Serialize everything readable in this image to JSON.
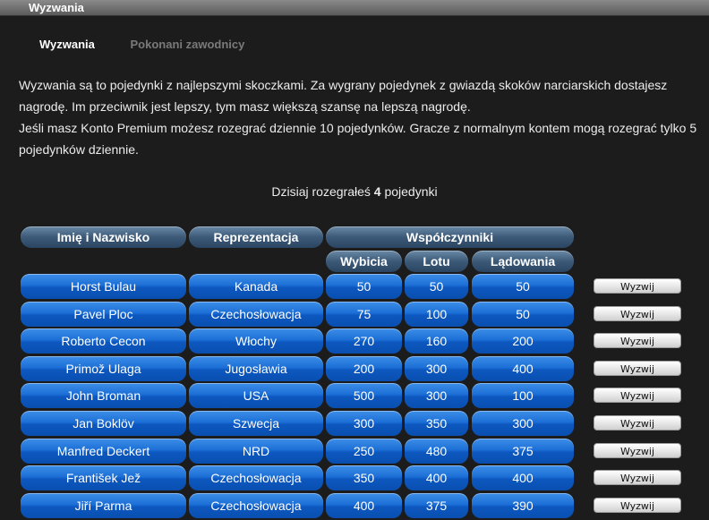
{
  "window": {
    "title": "Wyzwania"
  },
  "tabs": [
    {
      "label": "Wyzwania",
      "active": true
    },
    {
      "label": "Pokonani zawodnicy",
      "active": false
    }
  ],
  "intro": {
    "line1": "Wyzwania są to pojedynki z najlepszymi skoczkami. Za wygrany pojedynek z gwiazdą skoków narciarskich dostajesz nagrodę. Im przeciwnik jest lepszy, tym masz większą szansę na lepszą nagrodę.",
    "line2": "Jeśli masz Konto Premium możesz rozegrać dziennie 10 pojedynków. Gracze z normalnym kontem mogą rozegrać tylko 5 pojedynków dziennie."
  },
  "today": {
    "prefix": "Dzisiaj rozegrałeś ",
    "count": "4",
    "suffix": " pojedynki"
  },
  "table": {
    "headers": {
      "name": "Imię i Nazwisko",
      "country": "Reprezentacja",
      "coefficients": "Współczynniki",
      "takeoff": "Wybicia",
      "flight": "Lotu",
      "landing": "Lądowania"
    },
    "challenge_label": "Wyzwij",
    "rows": [
      {
        "name": "Horst Bulau",
        "country": "Kanada",
        "takeoff": "50",
        "flight": "50",
        "landing": "50"
      },
      {
        "name": "Pavel Ploc",
        "country": "Czechosłowacja",
        "takeoff": "75",
        "flight": "100",
        "landing": "50"
      },
      {
        "name": "Roberto Cecon",
        "country": "Włochy",
        "takeoff": "270",
        "flight": "160",
        "landing": "200"
      },
      {
        "name": "Primož Ulaga",
        "country": "Jugosławia",
        "takeoff": "200",
        "flight": "300",
        "landing": "400"
      },
      {
        "name": "John Broman",
        "country": "USA",
        "takeoff": "500",
        "flight": "300",
        "landing": "100"
      },
      {
        "name": "Jan Boklöv",
        "country": "Szwecja",
        "takeoff": "300",
        "flight": "350",
        "landing": "300"
      },
      {
        "name": "Manfred Deckert",
        "country": "NRD",
        "takeoff": "250",
        "flight": "480",
        "landing": "375"
      },
      {
        "name": "František Jež",
        "country": "Czechosłowacja",
        "takeoff": "350",
        "flight": "400",
        "landing": "400"
      },
      {
        "name": "Jiří Parma",
        "country": "Czechosłowacja",
        "takeoff": "400",
        "flight": "375",
        "landing": "390"
      }
    ]
  }
}
